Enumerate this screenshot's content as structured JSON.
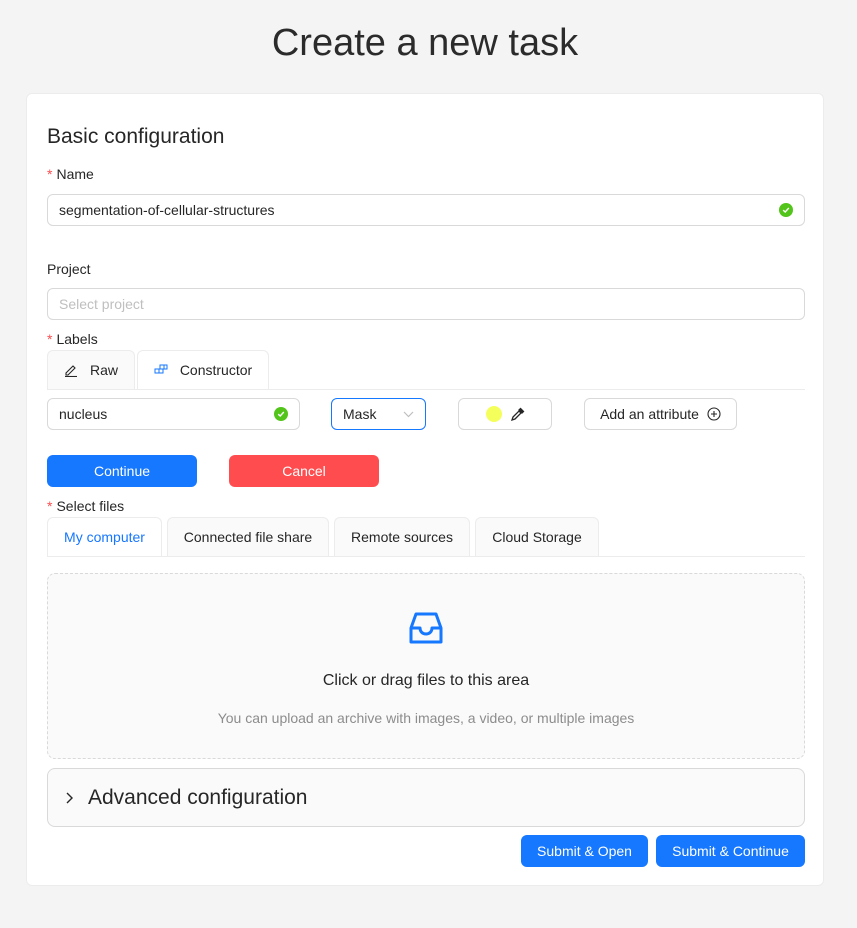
{
  "page": {
    "title": "Create a new task"
  },
  "basic": {
    "title": "Basic configuration",
    "name_label": "Name",
    "name_value": "segmentation-of-cellular-structures",
    "project_label": "Project",
    "project_placeholder": "Select project",
    "labels_label": "Labels"
  },
  "label_tabs": {
    "raw": "Raw",
    "constructor": "Constructor"
  },
  "label_editor": {
    "name_value": "nucleus",
    "type_selected": "Mask",
    "color": "#f5ff5c",
    "add_attribute": "Add an attribute",
    "continue": "Continue",
    "cancel": "Cancel"
  },
  "files": {
    "label": "Select files",
    "tabs": [
      "My computer",
      "Connected file share",
      "Remote sources",
      "Cloud Storage"
    ],
    "drop_title": "Click or drag files to this area",
    "drop_hint": "You can upload an archive with images, a video, or multiple images"
  },
  "advanced": {
    "title": "Advanced configuration"
  },
  "footer": {
    "submit_open": "Submit & Open",
    "submit_continue": "Submit & Continue"
  },
  "colors": {
    "primary": "#1677ff",
    "danger": "#ff4d4f",
    "success": "#52c41a"
  },
  "icons": [
    "check-circle-icon",
    "edit-icon",
    "build-icon",
    "eyedropper-icon",
    "plus-circle-icon",
    "inbox-icon",
    "chevron-right-icon",
    "chevron-down-icon"
  ]
}
